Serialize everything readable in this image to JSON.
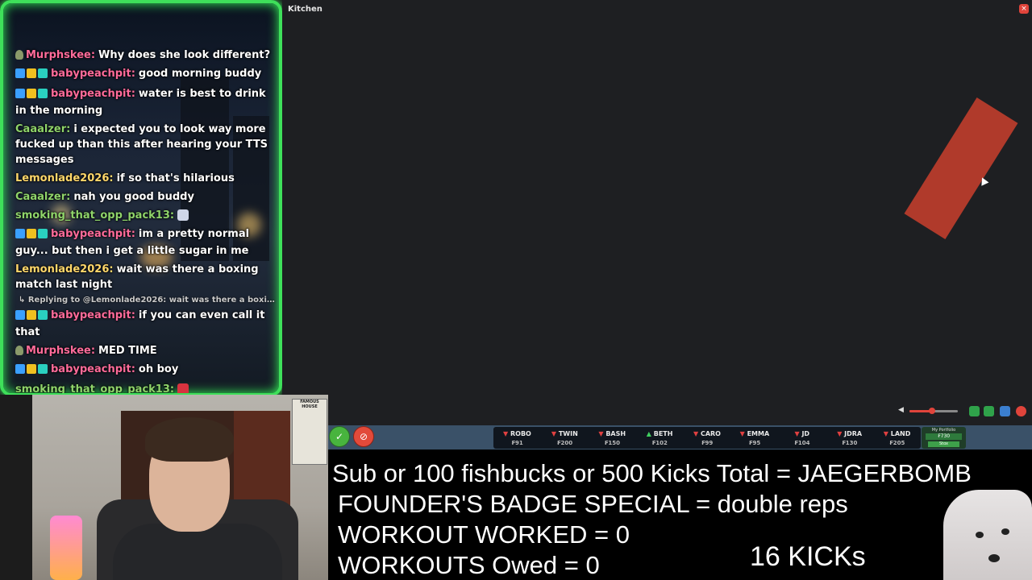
{
  "chat": {
    "messages": [
      {
        "user": "Murphskee:",
        "user_color": "#ff6b9a",
        "text": "Why does she look different?",
        "badges": "gray"
      },
      {
        "user": "babypeachpit:",
        "user_color": "#ff6b9a",
        "text": "good morning buddy",
        "badges": "sub"
      },
      {
        "user": "babypeachpit:",
        "user_color": "#ff6b9a",
        "text": "water is best to drink in the morning",
        "badges": "sub"
      },
      {
        "user": "Caaalzer:",
        "user_color": "#8fd46a",
        "text": "i expected you to look way more fucked up than this after hearing your TTS messages",
        "badges": "none"
      },
      {
        "user": "Lemonlade2026:",
        "user_color": "#ffd76a",
        "text": "if so that's hilarious",
        "badges": "none"
      },
      {
        "user": "Caaalzer:",
        "user_color": "#8fd46a",
        "text": "nah you good buddy",
        "badges": "none"
      },
      {
        "user": "smoking_that_opp_pack13:",
        "user_color": "#8fd46a",
        "text": "",
        "badges": "none",
        "emoji": "#cfd6e8"
      },
      {
        "user": "babypeachpit:",
        "user_color": "#ff6b9a",
        "text": "im a pretty normal guy... but then i get a little sugar in me",
        "badges": "sub"
      },
      {
        "user": "Lemonlade2026:",
        "user_color": "#ffd76a",
        "text": "wait was there a boxing match last night",
        "badges": "none"
      }
    ],
    "reply_line": "↳ Replying to @Lemonlade2026: wait was there a boxing ...",
    "messages_after": [
      {
        "user": "babypeachpit:",
        "user_color": "#ff6b9a",
        "text": "if you can even call it that",
        "badges": "sub"
      },
      {
        "user": "Murphskee:",
        "user_color": "#ff6b9a",
        "text": "MED TIME",
        "badges": "gray"
      },
      {
        "user": "babypeachpit:",
        "user_color": "#ff6b9a",
        "text": "oh boy",
        "badges": "sub"
      },
      {
        "user": "smoking_that_opp_pack13:",
        "user_color": "#8fd46a",
        "text": "",
        "badges": "none",
        "emoji": "#d8333f"
      }
    ]
  },
  "kitchen": {
    "title": "Kitchen",
    "close_label": "×"
  },
  "controls": {
    "icons": [
      "volume-icon",
      "volume-slider",
      "screenshot-icon",
      "share-icon",
      "fullscreen-icon",
      "record-icon"
    ]
  },
  "webcam": {
    "poster_text": "FAMOUS HOUSE"
  },
  "ticker": {
    "items": [
      {
        "name": "ROBO",
        "value": "₣91",
        "dir": "down"
      },
      {
        "name": "TWIN",
        "value": "₣200",
        "dir": "down"
      },
      {
        "name": "BASH",
        "value": "₣150",
        "dir": "down"
      },
      {
        "name": "BETH",
        "value": "₣102",
        "dir": "up"
      },
      {
        "name": "CARO",
        "value": "₣99",
        "dir": "down"
      },
      {
        "name": "EMMA",
        "value": "₣95",
        "dir": "down"
      },
      {
        "name": "JD",
        "value": "₣104",
        "dir": "down"
      },
      {
        "name": "JDRA",
        "value": "₣130",
        "dir": "down"
      },
      {
        "name": "LAND",
        "value": "₣205",
        "dir": "down"
      }
    ],
    "portfolio": {
      "title": "My Portfolio",
      "value": "₣730",
      "button": "Stox"
    }
  },
  "overlay": {
    "line1": "Sub or 100 fishbucks or 500 Kicks Total = JAEGERBOMB",
    "line2": "FOUNDER'S BADGE SPECIAL = double reps",
    "line3": "WORKOUT WORKED = 0",
    "line4": "WORKOUTS Owed = 0",
    "kicks": "16 KICKs"
  },
  "colors": {
    "chat_border": "#3ee05a",
    "ticker_bg": "#3a5168",
    "red_shape": "#b03a2b"
  }
}
